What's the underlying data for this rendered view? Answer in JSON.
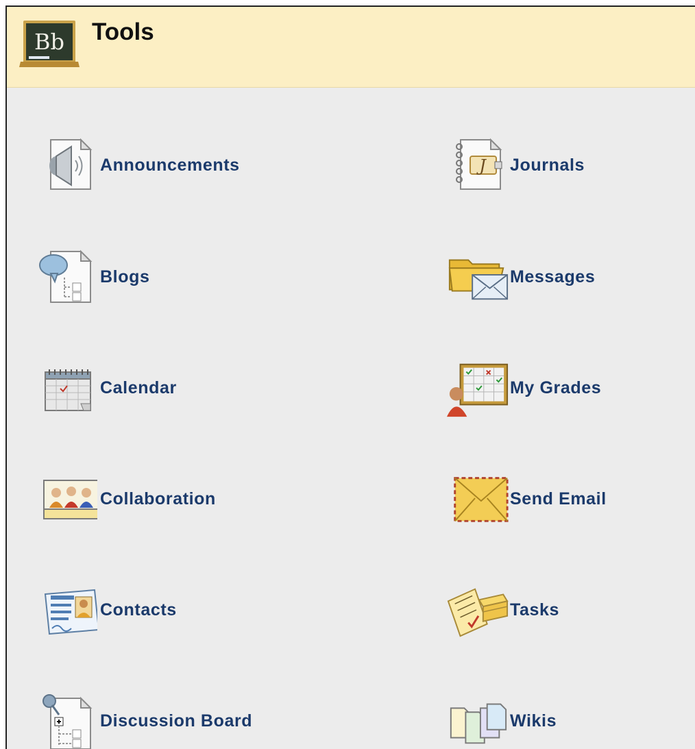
{
  "header": {
    "logo_text": "Bb",
    "title": "Tools"
  },
  "tools": [
    {
      "id": "announcements",
      "label": "Announcements",
      "icon": "announcements-icon"
    },
    {
      "id": "journals",
      "label": "Journals",
      "icon": "journals-icon"
    },
    {
      "id": "blogs",
      "label": "Blogs",
      "icon": "blogs-icon"
    },
    {
      "id": "messages",
      "label": "Messages",
      "icon": "messages-icon"
    },
    {
      "id": "calendar",
      "label": "Calendar",
      "icon": "calendar-icon"
    },
    {
      "id": "my-grades",
      "label": "My Grades",
      "icon": "my-grades-icon"
    },
    {
      "id": "collaboration",
      "label": "Collaboration",
      "icon": "collaboration-icon"
    },
    {
      "id": "send-email",
      "label": "Send Email",
      "icon": "send-email-icon"
    },
    {
      "id": "contacts",
      "label": "Contacts",
      "icon": "contacts-icon"
    },
    {
      "id": "tasks",
      "label": "Tasks",
      "icon": "tasks-icon"
    },
    {
      "id": "discussion-board",
      "label": "Discussion Board",
      "icon": "discussion-board-icon"
    },
    {
      "id": "wikis",
      "label": "Wikis",
      "icon": "wikis-icon"
    }
  ],
  "colors": {
    "header_bg": "#fcefc4",
    "panel_bg": "#ececec",
    "link_text": "#1b3a6b"
  }
}
